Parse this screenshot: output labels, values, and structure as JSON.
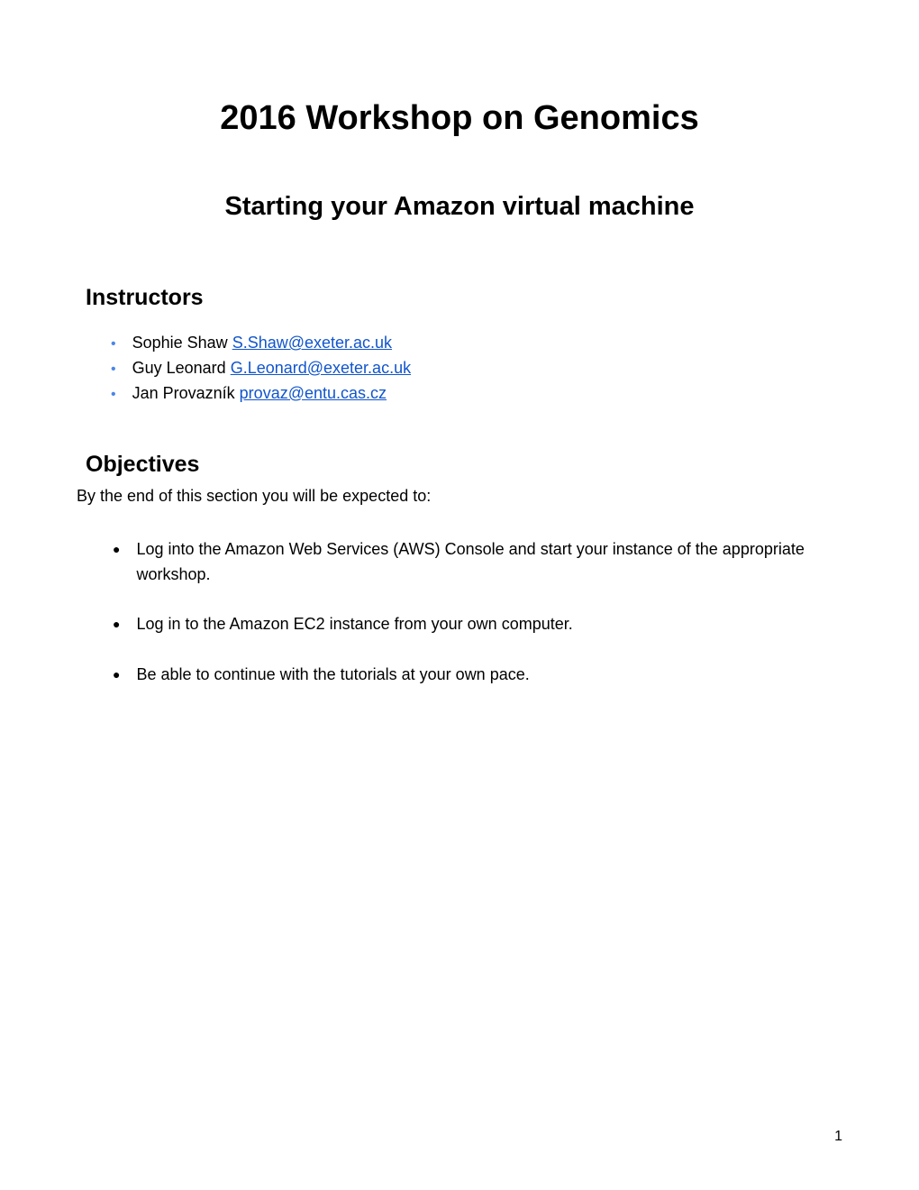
{
  "title": "2016 Workshop on Genomics",
  "subtitle": "Starting your Amazon virtual machine",
  "instructors_heading": "Instructors",
  "instructors": [
    {
      "name": "Sophie Shaw",
      "email": "S.Shaw@exeter.ac.uk"
    },
    {
      "name": "Guy Leonard",
      "email": "G.Leonard@exeter.ac.uk"
    },
    {
      "name": "Jan Provazník",
      "email": "provaz@entu.cas.cz"
    }
  ],
  "objectives_heading": "Objectives",
  "objectives_intro": "By the end of this section you will be expected to:",
  "objectives": [
    "Log into the Amazon Web Services (AWS) Console and start your instance of the appropriate workshop.",
    "Log in to the Amazon EC2 instance from your own computer.",
    "Be able to continue with the tutorials at your own pace."
  ],
  "page_number": "1"
}
